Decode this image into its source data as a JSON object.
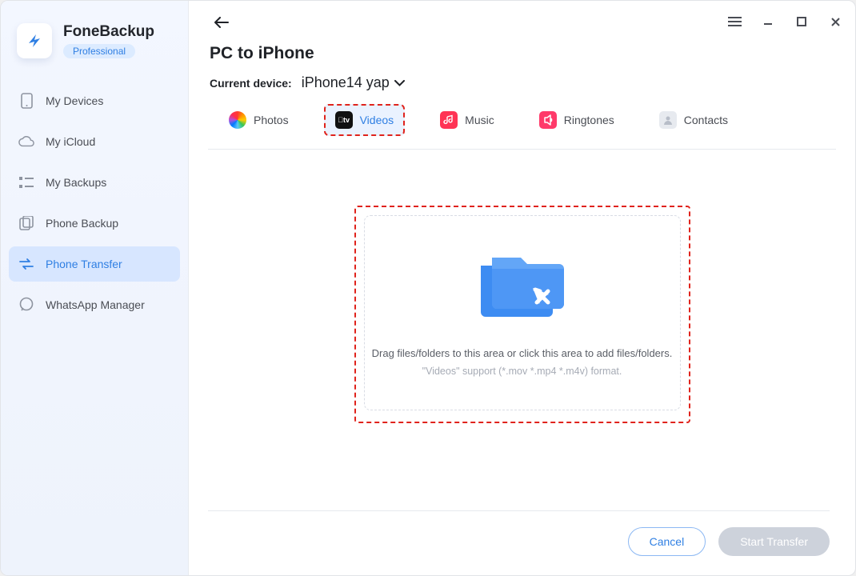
{
  "brand": {
    "name": "FoneBackup",
    "tier": "Professional"
  },
  "sidebar": {
    "items": [
      {
        "label": "My Devices"
      },
      {
        "label": "My iCloud"
      },
      {
        "label": "My Backups"
      },
      {
        "label": "Phone Backup"
      },
      {
        "label": "Phone Transfer"
      },
      {
        "label": "WhatsApp Manager"
      }
    ],
    "active_index": 4
  },
  "page": {
    "title": "PC to iPhone",
    "current_device_label": "Current device:",
    "current_device_name": "iPhone14 yap"
  },
  "categories": {
    "items": [
      {
        "label": "Photos"
      },
      {
        "label": "Videos"
      },
      {
        "label": "Music"
      },
      {
        "label": "Ringtones"
      },
      {
        "label": "Contacts"
      }
    ],
    "active_index": 1
  },
  "dropzone": {
    "hint1": "Drag files/folders to this area or click this area to add files/folders.",
    "hint2": "\"Videos\" support (*.mov *.mp4 *.m4v) format."
  },
  "footer": {
    "cancel": "Cancel",
    "start": "Start Transfer"
  },
  "colors": {
    "accent": "#2f7fe3",
    "highlight_dash": "#e0231c"
  }
}
